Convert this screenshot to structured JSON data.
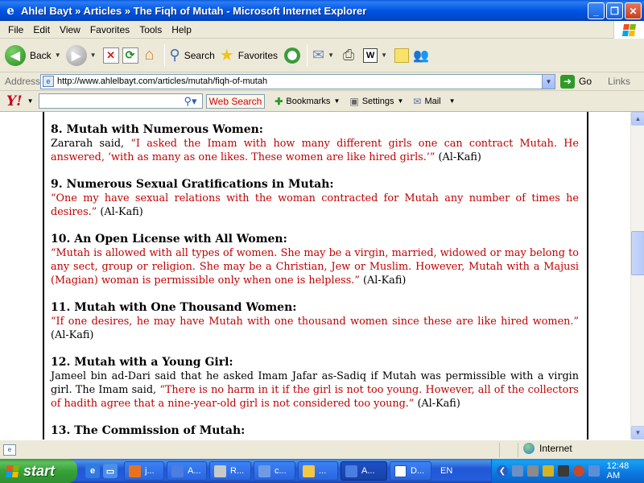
{
  "window": {
    "title": "Ahlel Bayt » Articles » The Fiqh of Mutah - Microsoft Internet Explorer",
    "minimize_label": "_",
    "maximize_label": "❐",
    "close_label": "✕"
  },
  "menu": [
    "File",
    "Edit",
    "View",
    "Favorites",
    "Tools",
    "Help"
  ],
  "toolbar": {
    "back_label": "Back",
    "search_label": "Search",
    "favorites_label": "Favorites"
  },
  "address": {
    "label": "Address",
    "url": "http://www.ahlelbayt.com/articles/mutah/fiqh-of-mutah",
    "go_label": "Go",
    "links_label": "Links"
  },
  "yahoo": {
    "logo": "Y!",
    "search_button": "Web Search",
    "bookmarks": "Bookmarks",
    "settings": "Settings",
    "mail": "Mail"
  },
  "sections": [
    {
      "heading": "8. Mutah with Numerous Women:",
      "lead": "Zararah said, ",
      "quote": "“I asked the Imam with how many different girls one can contract Mutah. He answered, ‘with as many as one likes. These women are like hired girls.’”",
      "source": " (Al-Kafi)"
    },
    {
      "heading": "9. Numerous Sexual Gratifications in Mutah:",
      "lead": "",
      "quote": "“One my have sexual relations with the woman contracted for Mutah any number of times he desires.”",
      "source": " (Al-Kafi)"
    },
    {
      "heading": "10. An Open License with All Women:",
      "lead": "",
      "quote": "“Mutah is allowed with all types of women. She may be a virgin, married, widowed or may belong to any sect, group or religion. She may be a Christian, Jew or Muslim. However, Mutah with a Majusi (Magian) woman is permissible only when one is helpless.”",
      "source": " (Al-Kafi)"
    },
    {
      "heading": "11. Mutah with One Thousand Women:",
      "lead": "",
      "quote": "“If one desires, he may have Mutah with one thousand women since these are like hired women.”",
      "source": " (Al-Kafi)"
    },
    {
      "heading": "12. Mutah with a Young Girl:",
      "lead": "Jameel bin ad-Dari said that he asked Imam Jafar as-Sadiq if Mutah was permissible with a virgin girl. The Imam said, ",
      "quote": "“There is no harm in it if the girl is not too young. However, all of the collectors of hadith agree that a nine-year-old girl is not considered too young.”",
      "source": " (Al-Kafi)"
    },
    {
      "heading": "13. The Commission of Mutah:",
      "lead": "",
      "quote": "",
      "source": ""
    }
  ],
  "status": {
    "zone": "Internet"
  },
  "taskbar": {
    "start_label": "start",
    "tasks": [
      "j...",
      "A...",
      "R...",
      "c...",
      "...",
      "A...",
      "D..."
    ],
    "language": "EN",
    "clock": "12:48 AM"
  },
  "colors": {
    "quote_red": "#c00000",
    "title_blue": "#0055e5",
    "taskbar_blue": "#245edb",
    "start_green": "#37a237"
  }
}
